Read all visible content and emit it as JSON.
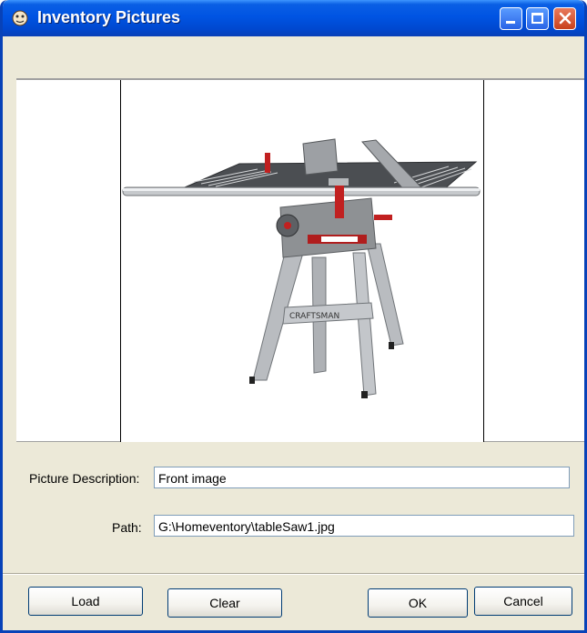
{
  "window": {
    "title": "Inventory Pictures",
    "icon": "app-icon",
    "controls": {
      "minimize": "minimize-icon",
      "maximize": "maximize-icon",
      "close": "close-icon"
    }
  },
  "image": {
    "subject": "table saw",
    "icon": "table-saw-photo"
  },
  "form": {
    "description_label": "Picture Description:",
    "description_value": "Front image",
    "path_label": "Path:",
    "path_value": "G:\\Homeventory\\tableSaw1.jpg"
  },
  "buttons": {
    "load": "Load",
    "clear": "Clear",
    "ok": "OK",
    "cancel": "Cancel"
  },
  "colors": {
    "titlebar": "#0054e3",
    "window_bg": "#ece9d8",
    "close": "#c8411c"
  }
}
